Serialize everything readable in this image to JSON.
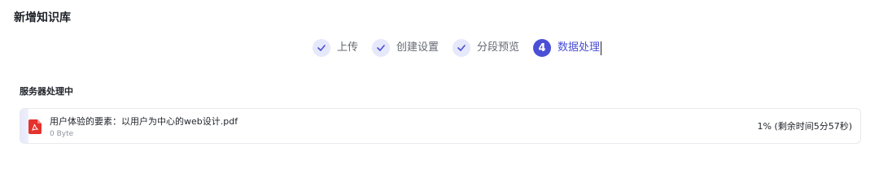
{
  "page": {
    "title": "新增知识库"
  },
  "steps": [
    {
      "label": "上传",
      "state": "done",
      "icon": "check-icon"
    },
    {
      "label": "创建设置",
      "state": "done",
      "icon": "check-icon"
    },
    {
      "label": "分段预览",
      "state": "done",
      "icon": "check-icon"
    },
    {
      "label": "数据处理",
      "state": "active",
      "number": "4"
    }
  ],
  "processing": {
    "section_label": "服务器处理中",
    "file": {
      "name": "用户体验的要素：以用户为中心的web设计.pdf",
      "size": "0 Byte",
      "status": "1% (剩余时间5分57秒)",
      "progress_percent": 1,
      "icon": "pdf-icon"
    }
  },
  "colors": {
    "accent": "#4a4fd6",
    "step_done_bg": "#e6e8fb",
    "pdf_red": "#e5322d",
    "progress_fill": "#e6e7fb"
  }
}
